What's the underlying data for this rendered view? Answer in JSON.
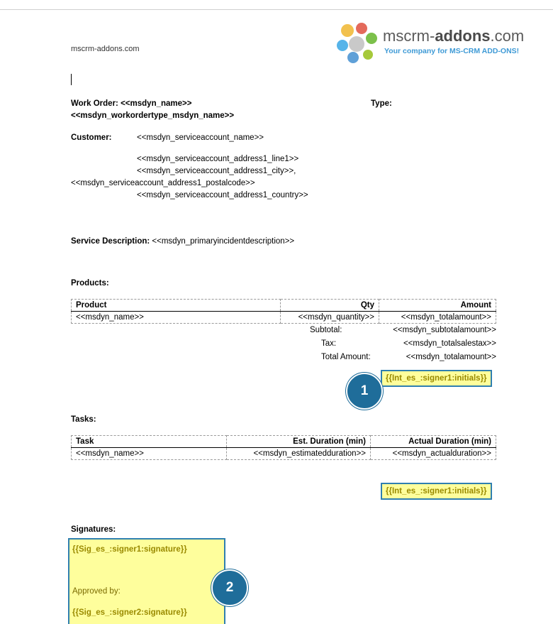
{
  "header": {
    "site": "mscrm-addons.com",
    "logo_name_light": "mscrm-",
    "logo_name_bold": "addons",
    "logo_name_tail": ".com",
    "logo_tagline": "Your company for MS-CRM ADD-ONS!"
  },
  "work_order": {
    "label": "Work Order:",
    "value": "<<msdyn_name>>",
    "type_label": "Type:",
    "type_value": "<<msdyn_workordertype_msdyn_name>>"
  },
  "customer": {
    "label": "Customer:",
    "name": "<<msdyn_serviceaccount_name>>",
    "line1": "<<msdyn_serviceaccount_address1_line1>>",
    "city": "<<msdyn_serviceaccount_address1_city>>,",
    "postalcode": "<<msdyn_serviceaccount_address1_postalcode>>",
    "country": "<<msdyn_serviceaccount_address1_country>>"
  },
  "service": {
    "label": "Service Description:",
    "value": "<<msdyn_primaryincidentdescription>>"
  },
  "products": {
    "heading": "Products:",
    "columns": [
      "Product",
      "Qty",
      "Amount"
    ],
    "row": [
      "<<msdyn_name>>",
      "<<msdyn_quantity>>",
      "<<msdyn_totalamount>>"
    ],
    "subtotal_label": "Subtotal:",
    "subtotal_value": "<<msdyn_subtotalamount>>",
    "tax_label": "Tax:",
    "tax_value": "<<msdyn_totalsalestax>>",
    "total_label": "Total Amount:",
    "total_value": "<<msdyn_totalamount>>",
    "initials_tag": "{{Int_es_:signer1:initials}}"
  },
  "tasks": {
    "heading": "Tasks:",
    "columns": [
      "Task",
      "Est. Duration (min)",
      "Actual Duration (min)"
    ],
    "row": [
      "<<msdyn_name>>",
      "<<msdyn_estimatedduration>>",
      "<<msdyn_actualduration>>"
    ],
    "initials_tag": "{{Int_es_:signer1:initials}}"
  },
  "signatures": {
    "heading": "Signatures:",
    "signer1": "{{Sig_es_:signer1:signature}}",
    "approved_by": "Approved by:",
    "signer2": "{{Sig_es_:signer2:signature}}"
  },
  "badges": [
    "1",
    "2"
  ],
  "colors": {
    "highlight": "#fefe9c",
    "tag_border": "#2f7fb0",
    "tag_text": "#9a8a00",
    "badge": "#1f6d9a",
    "logo_blue": "#3e9ad6"
  }
}
